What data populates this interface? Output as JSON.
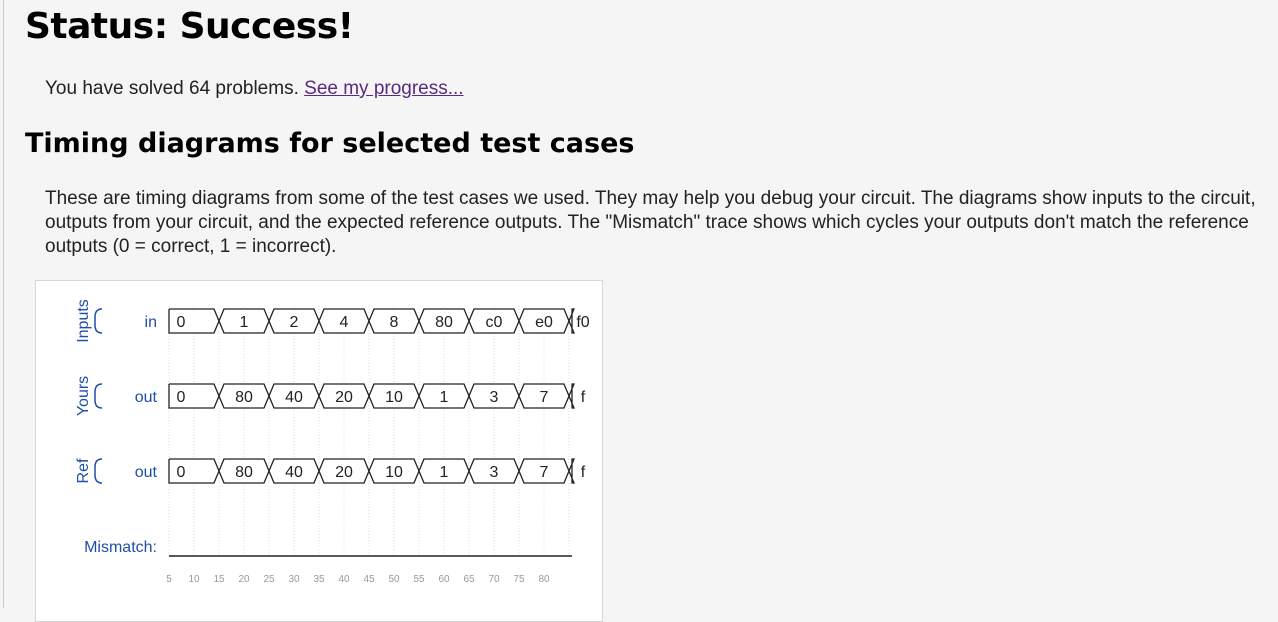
{
  "status_heading": "Status: Success!",
  "solved": {
    "text": "You have solved 64 problems.",
    "link": "See my progress..."
  },
  "section_heading": "Timing diagrams for selected test cases",
  "description": "These are timing diagrams from some of the test cases we used. They may help you debug your circuit. The diagrams show inputs to the circuit, outputs from your circuit, and the expected reference outputs. The \"Mismatch\" trace shows which cycles your outputs don't match the reference outputs (0 = correct, 1 = incorrect).",
  "colors": {
    "label_blue": "#1f4fa8",
    "link_purple": "#5a2a82"
  },
  "timing": {
    "groups": [
      {
        "label": "Inputs",
        "signal": "in",
        "values": [
          "0",
          "1",
          "2",
          "4",
          "8",
          "80",
          "c0",
          "e0",
          "f0"
        ]
      },
      {
        "label": "Yours",
        "signal": "out",
        "values": [
          "0",
          "80",
          "40",
          "20",
          "10",
          "1",
          "3",
          "7",
          "f"
        ]
      },
      {
        "label": "Ref",
        "signal": "out",
        "values": [
          "0",
          "80",
          "40",
          "20",
          "10",
          "1",
          "3",
          "7",
          "f"
        ]
      }
    ],
    "mismatch_label": "Mismatch:",
    "mismatch_value": 0,
    "x_ticks": [
      "5",
      "10",
      "15",
      "20",
      "25",
      "30",
      "35",
      "40",
      "45",
      "50",
      "55",
      "60",
      "65",
      "70",
      "75",
      "80"
    ]
  }
}
